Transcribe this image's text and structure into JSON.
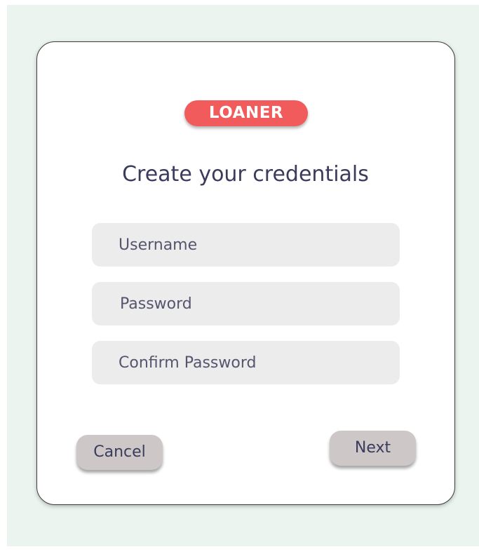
{
  "app": {
    "logo_text": "LOANER"
  },
  "form": {
    "title": "Create your credentials",
    "username_placeholder": "Username",
    "password_placeholder": "Password",
    "confirm_password_placeholder": "Confirm Password"
  },
  "actions": {
    "cancel_label": "Cancel",
    "next_label": "Next"
  },
  "colors": {
    "background": "#ebf4ef",
    "card": "#ffffff",
    "brand": "#f25b5b",
    "field": "#ececec",
    "button": "#cdc7c7",
    "text": "#3b3b5c"
  }
}
